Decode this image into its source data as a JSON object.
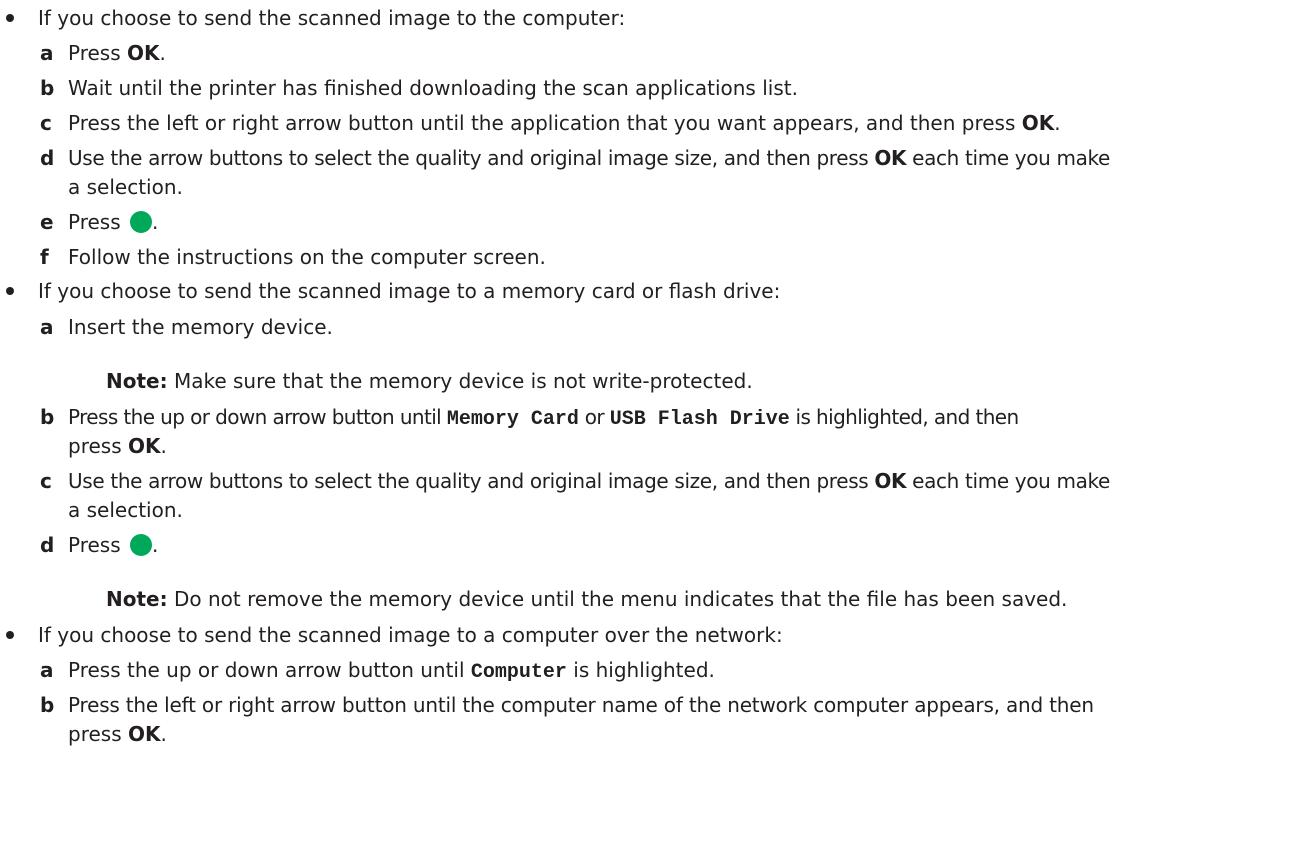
{
  "sections": [
    {
      "intro": "If you choose to send the scanned image to the computer:",
      "steps": [
        {
          "letter": "a",
          "pre": "Press ",
          "bold": "OK",
          "post": "."
        },
        {
          "letter": "b",
          "text": "Wait until the printer has finished downloading the scan applications list."
        },
        {
          "letter": "c",
          "pre": "Press the left or right arrow button until the application that you want appears, and then press ",
          "bold": "OK",
          "post": "."
        },
        {
          "letter": "d",
          "pre": "Use the arrow buttons to select the quality and original image size, and then press ",
          "bold": "OK",
          "post": " each time you make",
          "cont": "a selection."
        },
        {
          "letter": "e",
          "pre": "Press ",
          "icon": "start-button-icon",
          "post": "."
        },
        {
          "letter": "f",
          "text": "Follow the instructions on the computer screen."
        }
      ]
    },
    {
      "intro": "If you choose to send the scanned image to a memory card or flash drive:",
      "steps": [
        {
          "letter": "a",
          "text": "Insert the memory device.",
          "note_label": "Note:",
          "note_text": " Make sure that the memory device is not write-protected."
        },
        {
          "letter": "b",
          "pre": "Press the up or down arrow button until ",
          "mono1": "Memory Card",
          "mid": " or ",
          "mono2": "USB Flash Drive",
          "post": " is highlighted, and then",
          "cont_pre": "press ",
          "cont_bold": "OK",
          "cont_post": "."
        },
        {
          "letter": "c",
          "pre": "Use the arrow buttons to select the quality and original image size, and then press ",
          "bold": "OK",
          "post": " each time you make",
          "cont": "a selection."
        },
        {
          "letter": "d",
          "pre": "Press ",
          "icon": "start-button-icon",
          "post": ".",
          "note_label": "Note:",
          "note_text": " Do not remove the memory device until the menu indicates that the file has been saved."
        }
      ]
    },
    {
      "intro": "If you choose to send the scanned image to a computer over the network:",
      "steps": [
        {
          "letter": "a",
          "pre": "Press the up or down arrow button until ",
          "mono1": "Computer",
          "post": " is highlighted."
        },
        {
          "letter": "b",
          "text": "Press the left or right arrow button until the computer name of the network computer appears, and then",
          "cont_pre": "press ",
          "cont_bold": "OK",
          "cont_post": "."
        }
      ]
    }
  ],
  "colors": {
    "text": "#231f20",
    "start_button": "#00a85a"
  }
}
